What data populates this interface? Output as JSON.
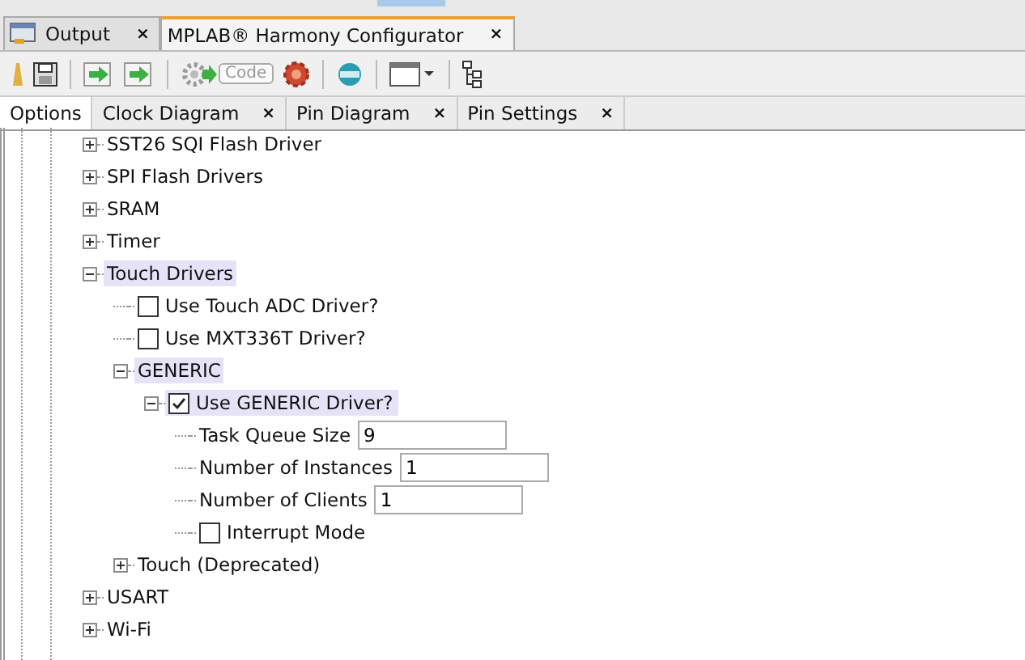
{
  "window_tabs": [
    {
      "label": "Output",
      "close": "×",
      "selected": false
    },
    {
      "label": "MPLAB® Harmony Configurator",
      "close": "×",
      "selected": true
    }
  ],
  "toolbar": {
    "code_label": "Code"
  },
  "editor_tabs": [
    {
      "label": "Options",
      "selected": true
    },
    {
      "label": "Clock Diagram",
      "close": "×",
      "selected": false
    },
    {
      "label": "Pin Diagram",
      "close": "×",
      "selected": false
    },
    {
      "label": "Pin Settings",
      "close": "×",
      "selected": false
    }
  ],
  "tree": [
    {
      "kind": "node",
      "label": "SST26 SQI Flash Driver",
      "expanded": false,
      "highlighted": false
    },
    {
      "kind": "node",
      "label": "SPI Flash Drivers",
      "expanded": false,
      "highlighted": false
    },
    {
      "kind": "node",
      "label": "SRAM",
      "expanded": false,
      "highlighted": false
    },
    {
      "kind": "node",
      "label": "Timer",
      "expanded": false,
      "highlighted": false
    },
    {
      "kind": "node",
      "label": "Touch Drivers",
      "expanded": true,
      "highlighted": true,
      "children": [
        {
          "kind": "checkbox",
          "label": "Use Touch ADC Driver?",
          "checked": false,
          "highlighted": false
        },
        {
          "kind": "checkbox",
          "label": "Use MXT336T Driver?",
          "checked": false,
          "highlighted": false
        },
        {
          "kind": "node",
          "label": "GENERIC",
          "expanded": true,
          "highlighted": true,
          "children": [
            {
              "kind": "checkbox",
              "label": "Use GENERIC Driver?",
              "checked": true,
              "expanded": true,
              "highlighted": true,
              "children": [
                {
                  "kind": "field",
                  "label": "Task Queue Size",
                  "value": "9",
                  "highlighted": false
                },
                {
                  "kind": "field",
                  "label": "Number of Instances",
                  "value": "1",
                  "highlighted": false
                },
                {
                  "kind": "field",
                  "label": "Number of Clients",
                  "value": "1",
                  "highlighted": false
                },
                {
                  "kind": "checkbox",
                  "label": "Interrupt Mode",
                  "checked": false,
                  "highlighted": false
                }
              ]
            }
          ]
        },
        {
          "kind": "node",
          "label": "Touch (Deprecated)",
          "expanded": false,
          "highlighted": false
        }
      ]
    },
    {
      "kind": "node",
      "label": "USART",
      "expanded": false,
      "highlighted": false
    },
    {
      "kind": "node",
      "label": "Wi-Fi",
      "expanded": false,
      "highlighted": false
    }
  ]
}
